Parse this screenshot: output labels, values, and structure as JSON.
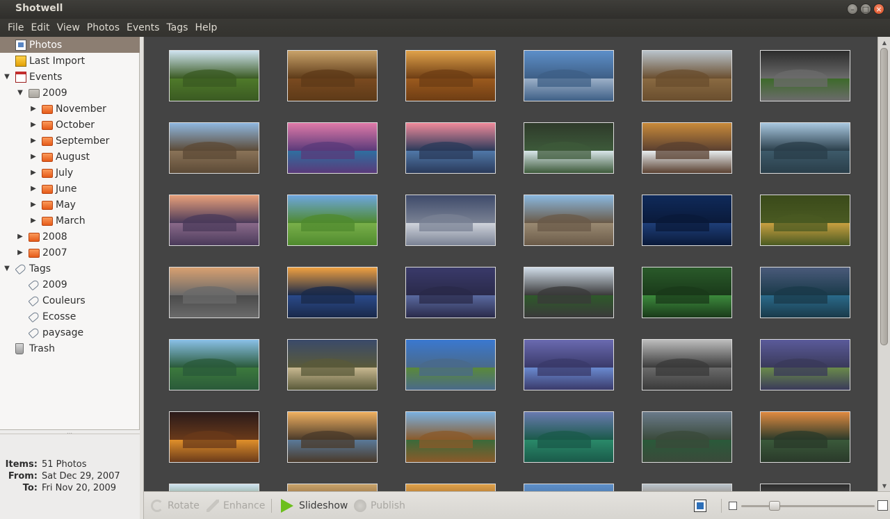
{
  "window": {
    "title": "Shotwell",
    "buttons": {
      "minimize": "–",
      "maximize": "□",
      "close": "×"
    }
  },
  "menu": [
    "File",
    "Edit",
    "View",
    "Photos",
    "Events",
    "Tags",
    "Help"
  ],
  "sidebar": {
    "photos": "Photos",
    "last_import": "Last Import",
    "events": "Events",
    "year_2009": "2009",
    "months_2009": [
      "November",
      "October",
      "September",
      "August",
      "July",
      "June",
      "May",
      "March"
    ],
    "year_2008": "2008",
    "year_2007": "2007",
    "tags": "Tags",
    "tag_items": [
      "2009",
      "Couleurs",
      "Ecosse",
      "paysage"
    ],
    "trash": "Trash"
  },
  "info": {
    "items_label": "Items:",
    "items_value": "51 Photos",
    "from_label": "From:",
    "from_value": "Sat Dec 29, 2007",
    "to_label": "To:",
    "to_value": "Fri Nov 20, 2009"
  },
  "toolbar": {
    "rotate": "Rotate",
    "enhance": "Enhance",
    "slideshow": "Slideshow",
    "publish": "Publish",
    "zoom_level": 0.25
  },
  "colors": {
    "photo_bg": "#444444",
    "selected_row": "#8c7e72",
    "slideshow_green": "#6cbf1d"
  }
}
